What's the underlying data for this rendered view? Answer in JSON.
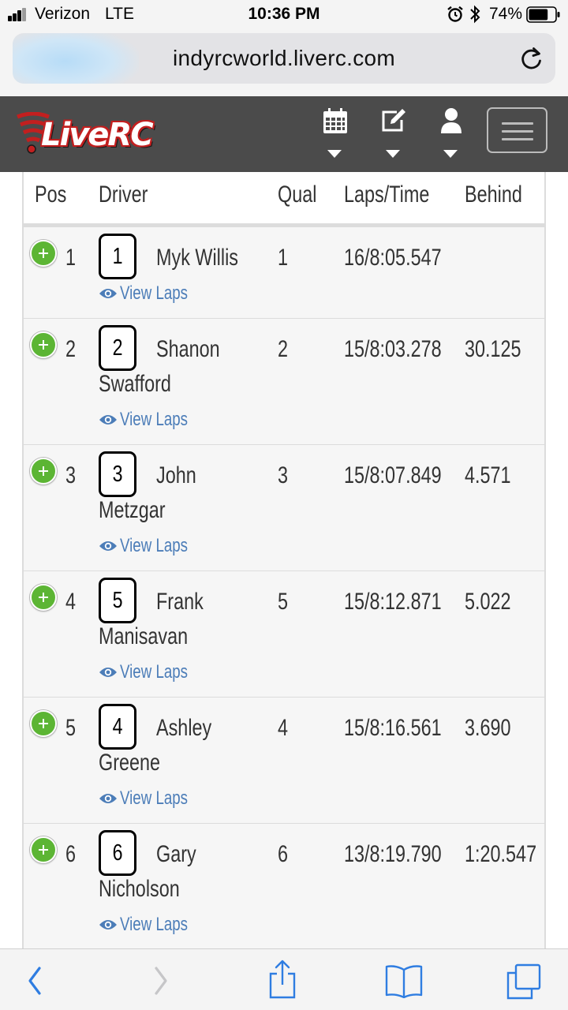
{
  "status_bar": {
    "carrier": "Verizon",
    "network": "LTE",
    "time": "10:36 PM",
    "battery_percent": "74%",
    "battery_level": 0.74,
    "icons": [
      "signal-bars-icon",
      "alarm-icon",
      "bluetooth-icon",
      "battery-icon"
    ]
  },
  "browser": {
    "url": "indyrcworld.liverc.com",
    "reload_icon": "reload-icon"
  },
  "header": {
    "logo_text": "LiveRC",
    "nav_icons": [
      "calendar-icon",
      "edit-icon",
      "user-icon"
    ],
    "menu_icon": "hamburger-menu-icon",
    "colors": {
      "background": "#4b4b4b",
      "logo_red": "#c21f1f"
    }
  },
  "table": {
    "headers": {
      "pos": "Pos",
      "driver": "Driver",
      "qual": "Qual",
      "laps_time": "Laps/Time",
      "behind": "Behind"
    },
    "view_laps_label": "View Laps",
    "rows": [
      {
        "pos": "1",
        "car": "1",
        "driver_line1": "Myk Willis",
        "driver_line2": "",
        "qual": "1",
        "laps_time": "16/8:05.547",
        "behind": ""
      },
      {
        "pos": "2",
        "car": "2",
        "driver_line1": "Shanon",
        "driver_line2": "Swafford",
        "qual": "2",
        "laps_time": "15/8:03.278",
        "behind": "30.125"
      },
      {
        "pos": "3",
        "car": "3",
        "driver_line1": "John",
        "driver_line2": "Metzgar",
        "qual": "3",
        "laps_time": "15/8:07.849",
        "behind": "4.571"
      },
      {
        "pos": "4",
        "car": "5",
        "driver_line1": "Frank",
        "driver_line2": "Manisavan",
        "qual": "5",
        "laps_time": "15/8:12.871",
        "behind": "5.022"
      },
      {
        "pos": "5",
        "car": "4",
        "driver_line1": "Ashley",
        "driver_line2": "Greene",
        "qual": "4",
        "laps_time": "15/8:16.561",
        "behind": "3.690"
      },
      {
        "pos": "6",
        "car": "6",
        "driver_line1": "Gary",
        "driver_line2": "Nicholson",
        "qual": "6",
        "laps_time": "13/8:19.790",
        "behind": "1:20.547"
      }
    ],
    "colors": {
      "expand_green": "#5cb534",
      "link_blue": "#4c7db8",
      "row_bg": "#f6f6f6"
    }
  },
  "toolbar": {
    "icons": [
      "back-icon",
      "forward-icon",
      "share-icon",
      "bookmarks-icon",
      "tabs-icon"
    ],
    "accent": "#2f7de1"
  }
}
